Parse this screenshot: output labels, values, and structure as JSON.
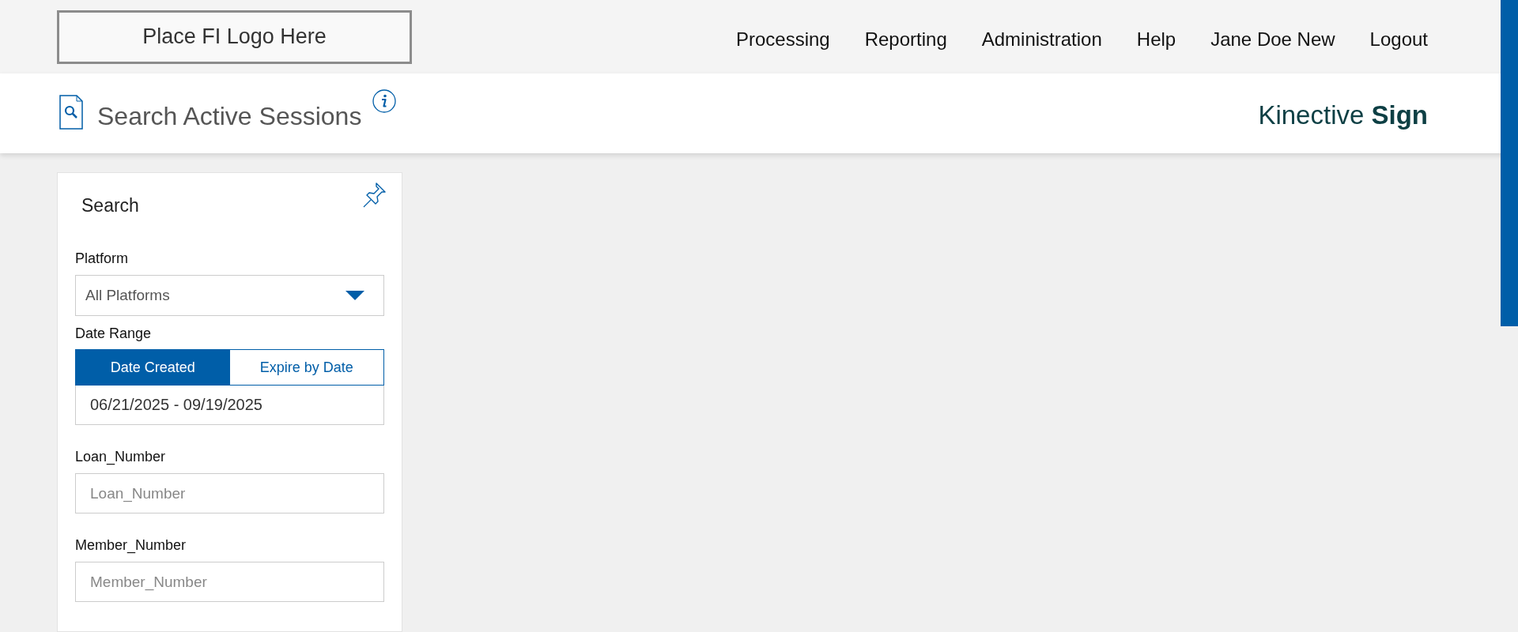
{
  "logo": {
    "text": "Place FI Logo Here"
  },
  "nav": [
    {
      "label": "Processing"
    },
    {
      "label": "Reporting"
    },
    {
      "label": "Administration"
    },
    {
      "label": "Help"
    },
    {
      "label": "Jane Doe New"
    },
    {
      "label": "Logout"
    }
  ],
  "page": {
    "title": "Search Active Sessions",
    "brand": "Kinective **Sign**"
  },
  "search_panel": {
    "title": "Search",
    "platform": {
      "label": "Platform",
      "value": "All Platforms"
    },
    "date_range": {
      "label": "Date Range",
      "options": [
        {
          "label": "Date Created",
          "selected": true
        },
        {
          "label": "Expire by Date",
          "selected": false
        }
      ],
      "value": "06/21/2025 - 09/19/2025"
    },
    "fields": [
      {
        "label": "Loan_Number",
        "placeholder": "Loan_Number"
      },
      {
        "label": "Member_Number",
        "placeholder": "Member_Number"
      }
    ]
  }
}
